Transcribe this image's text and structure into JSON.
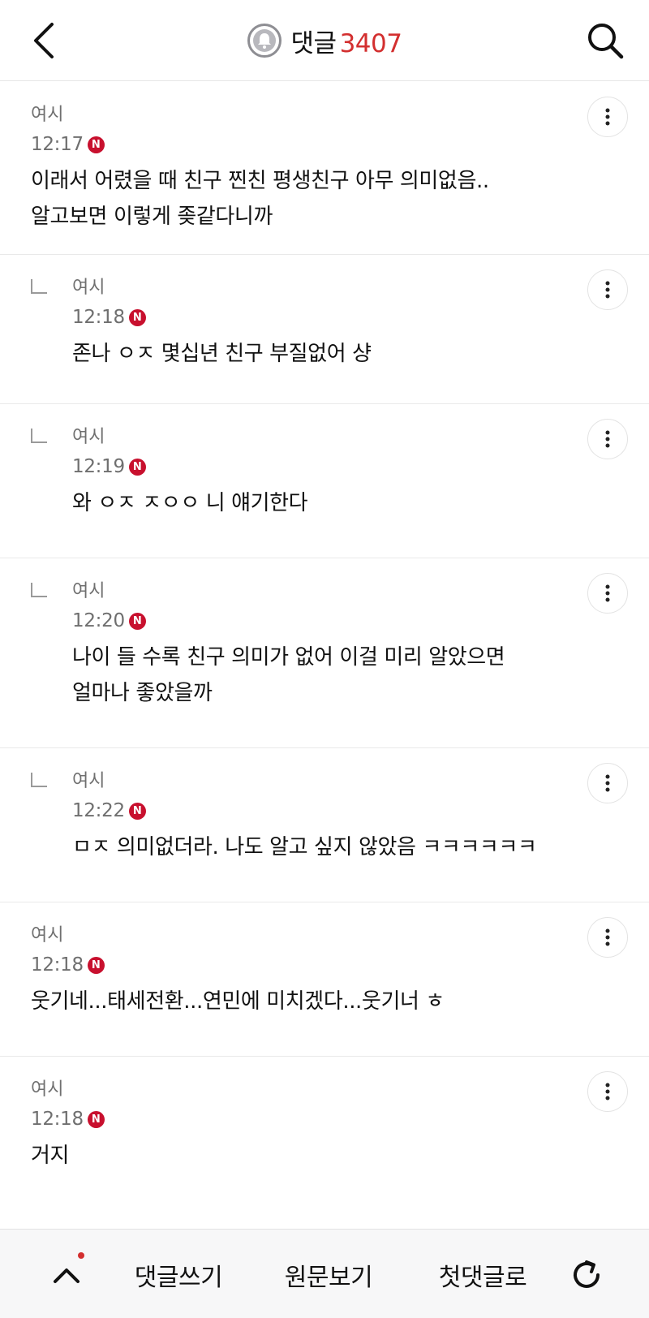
{
  "header": {
    "title": "댓글",
    "count": "3407",
    "icons": {
      "back": "chevron-left-icon",
      "bell": "bell-icon",
      "search": "search-icon"
    }
  },
  "comments": [
    {
      "type": "top",
      "author": "여시",
      "time": "12:17",
      "badge": "N",
      "text": "이래서 어렸을 때 친구 찐친 평생친구 아무 의미없음..\n알고보면 이렇게 좆같다니까"
    },
    {
      "type": "reply",
      "author": "여시",
      "time": "12:18",
      "badge": "N",
      "text": "존나 ㅇㅈ 몇십년 친구 부질없어 샹"
    },
    {
      "type": "reply",
      "author": "여시",
      "time": "12:19",
      "badge": "N",
      "text": "와 ㅇㅈ ㅈㅇㅇ 니 얘기한다"
    },
    {
      "type": "reply",
      "author": "여시",
      "time": "12:20",
      "badge": "N",
      "text": "나이 들 수록 친구 의미가 없어 이걸 미리 알았으면\n얼마나 좋았을까"
    },
    {
      "type": "reply",
      "author": "여시",
      "time": "12:22",
      "badge": "N",
      "text": "ㅁㅈ 의미없더라. 나도 알고 싶지 않았음 ㅋㅋㅋㅋㅋㅋ"
    },
    {
      "type": "top",
      "author": "여시",
      "time": "12:18",
      "badge": "N",
      "text": "웃기네...태세전환...연민에 미치겠다...웃기너 ㅎ"
    },
    {
      "type": "top",
      "author": "여시",
      "time": "12:18",
      "badge": "N",
      "text": "거지"
    }
  ],
  "bottom_bar": {
    "write": "댓글쓰기",
    "original": "원문보기",
    "first_comment": "첫댓글로",
    "icons": {
      "up": "chevron-up-icon",
      "refresh": "refresh-icon"
    },
    "up_notification_color": "#d32f2f"
  },
  "colors": {
    "accent": "#d32f2f",
    "badge": "#c8102e"
  }
}
